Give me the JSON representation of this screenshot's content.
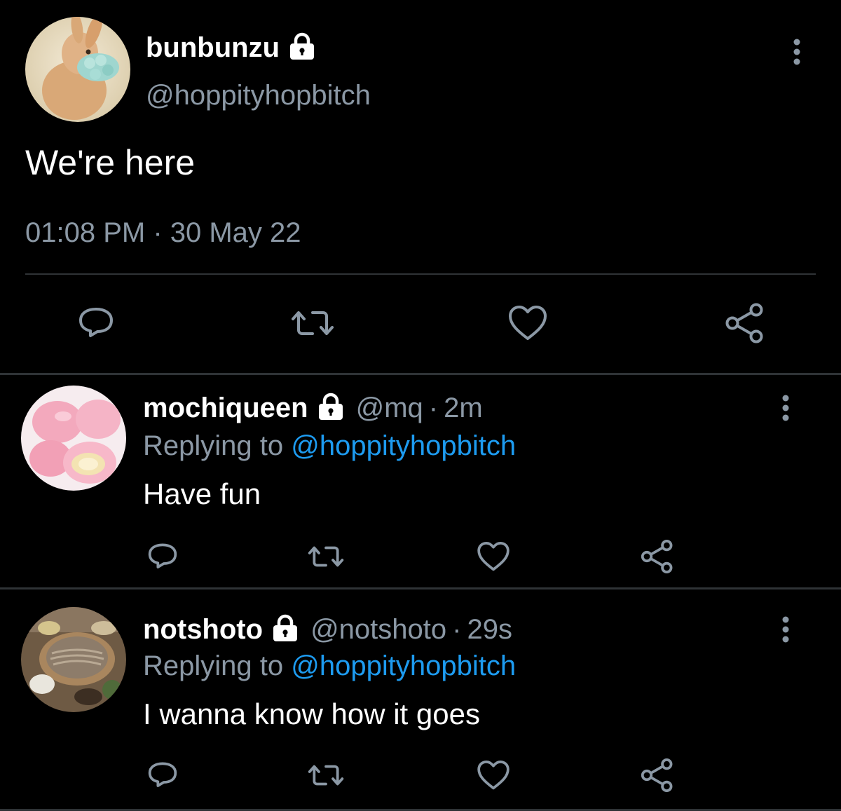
{
  "main_tweet": {
    "display_name": "bunbunzu",
    "handle": "@hoppityhopbitch",
    "text": "We're here",
    "timestamp": "01:08 PM · 30 May 22",
    "protected": true,
    "actions": [
      "reply-icon",
      "retweet-icon",
      "like-icon",
      "share-icon"
    ]
  },
  "replies": [
    {
      "display_name": "mochiqueen",
      "handle": "@mq",
      "separator": "·",
      "time": "2m",
      "replying_label": "Replying to",
      "replying_handle": "@hoppityhopbitch",
      "text": "Have fun",
      "protected": true
    },
    {
      "display_name": "notshoto",
      "handle": "@notshoto",
      "separator": "·",
      "time": "29s",
      "replying_label": "Replying to",
      "replying_handle": "@hoppityhopbitch",
      "text": "I wanna know how it goes",
      "protected": true
    }
  ],
  "colors": {
    "background": "#000000",
    "primary_text": "#ffffff",
    "secondary_text": "#8b98a5",
    "link": "#1d9bf0",
    "divider": "#2f3336"
  }
}
